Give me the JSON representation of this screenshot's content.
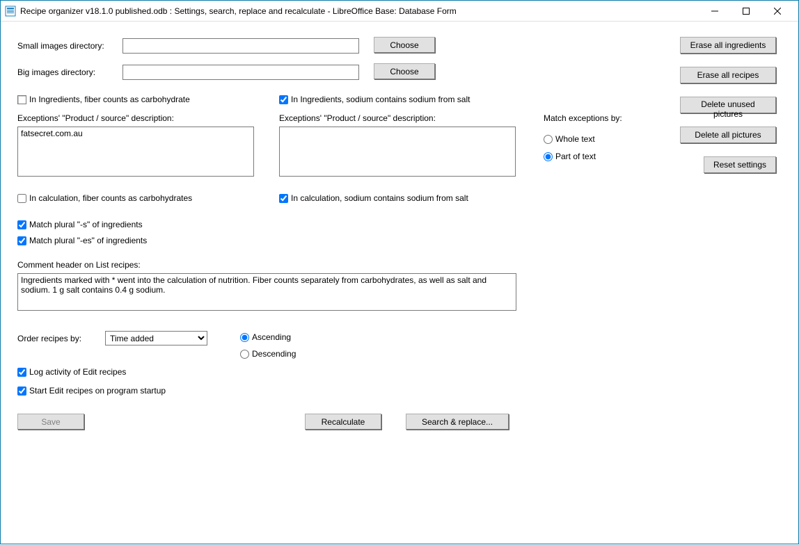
{
  "window": {
    "title": "Recipe organizer v18.1.0 published.odb : Settings, search, replace and recalculate - LibreOffice Base: Database Form"
  },
  "labels": {
    "small_images_dir": "Small images directory:",
    "big_images_dir": "Big images directory:",
    "choose": "Choose",
    "fiber_carb_ing": "In Ingredients, fiber counts as carbohydrate",
    "sodium_salt_ing": "In Ingredients, sodium contains sodium from salt",
    "exceptions_desc": "Exceptions' \"Product / source\" description:",
    "fiber_carb_calc": "In calculation, fiber counts as carbohydrates",
    "sodium_salt_calc": "In calculation, sodium contains sodium from salt",
    "match_s": "Match plural \"-s\" of ingredients",
    "match_es": "Match plural \"-es\" of ingredients",
    "comment_header": "Comment header on List recipes:",
    "order_recipes": "Order recipes by:",
    "ascending": "Ascending",
    "descending": "Descending",
    "log_activity": "Log activity of Edit recipes",
    "start_edit": "Start Edit recipes on program startup",
    "match_exceptions": "Match exceptions by:",
    "whole_text": "Whole text",
    "part_of_text": "Part of text"
  },
  "values": {
    "small_images_dir": "",
    "big_images_dir": "",
    "exceptions_left": "fatsecret.com.au",
    "exceptions_right": "",
    "comment_header": "Ingredients marked with * went into the calculation of nutrition. Fiber counts separately from carbohydrates, as well as salt and sodium. 1 g salt contains 0.4 g sodium.",
    "order_by": "Time added"
  },
  "buttons": {
    "save": "Save",
    "recalculate": "Recalculate",
    "search_replace": "Search & replace...",
    "erase_ingredients": "Erase all ingredients",
    "erase_recipes": "Erase all recipes",
    "delete_unused": "Delete unused pictures",
    "delete_all_pic": "Delete all pictures",
    "reset": "Reset settings"
  }
}
